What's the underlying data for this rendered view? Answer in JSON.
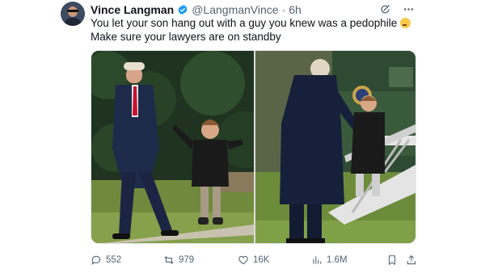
{
  "author": {
    "name": "Vince Langman",
    "handle": "@LangmanVince",
    "separator": "·",
    "time": "6h"
  },
  "tweet": {
    "line1": "You let your son hang out with a guy you knew was a pedophile",
    "line2": "Make sure your lawyers are on standby"
  },
  "icons": {
    "verified": "verified-badge-icon",
    "grok": "grok-icon",
    "more": "more-icon",
    "emoji": "thinking-face-icon"
  },
  "metrics": {
    "replies": "552",
    "reposts": "979",
    "likes": "16K",
    "views": "1.6M"
  },
  "colors": {
    "accent": "#1d9bf0",
    "text": "#0f1419",
    "muted": "#536471"
  }
}
